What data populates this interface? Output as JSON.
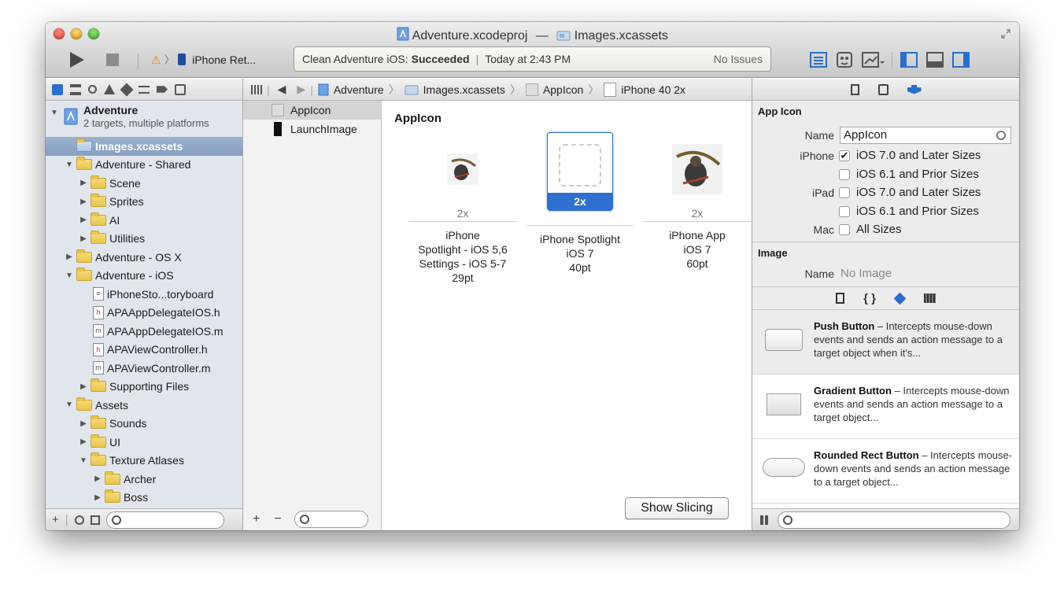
{
  "window": {
    "title_project": "Adventure.xcodeproj",
    "title_dash": "—",
    "title_assets": "Images.xcassets"
  },
  "toolbar": {
    "scheme_destination": "iPhone Ret...",
    "activity_prefix": "Clean Adventure iOS:",
    "activity_status": "Succeeded",
    "activity_sep": "|",
    "activity_time": "Today at 2:43 PM",
    "activity_issues": "No Issues"
  },
  "navigator": {
    "project_name": "Adventure",
    "project_sub": "2 targets, multiple platforms",
    "items": [
      {
        "label": "Images.xcassets",
        "indent": 1,
        "type": "xcassets",
        "selected": true,
        "disclosure": ""
      },
      {
        "label": "Adventure - Shared",
        "indent": 1,
        "type": "folder",
        "disclosure": "▼"
      },
      {
        "label": "Scene",
        "indent": 2,
        "type": "folder",
        "disclosure": "▶"
      },
      {
        "label": "Sprites",
        "indent": 2,
        "type": "folder",
        "disclosure": "▶"
      },
      {
        "label": "AI",
        "indent": 2,
        "type": "folder",
        "disclosure": "▶"
      },
      {
        "label": "Utilities",
        "indent": 2,
        "type": "folder",
        "disclosure": "▶"
      },
      {
        "label": "Adventure - OS X",
        "indent": 1,
        "type": "folder",
        "disclosure": "▶"
      },
      {
        "label": "Adventure - iOS",
        "indent": 1,
        "type": "folder",
        "disclosure": "▼"
      },
      {
        "label": "iPhoneSto...toryboard",
        "indent": 2,
        "type": "storyboard",
        "disclosure": ""
      },
      {
        "label": "APAAppDelegateIOS.h",
        "indent": 2,
        "type": "h",
        "disclosure": ""
      },
      {
        "label": "APAAppDelegateIOS.m",
        "indent": 2,
        "type": "m",
        "disclosure": ""
      },
      {
        "label": "APAViewController.h",
        "indent": 2,
        "type": "h",
        "disclosure": ""
      },
      {
        "label": "APAViewController.m",
        "indent": 2,
        "type": "m",
        "disclosure": ""
      },
      {
        "label": "Supporting Files",
        "indent": 2,
        "type": "folder",
        "disclosure": "▶"
      },
      {
        "label": "Assets",
        "indent": 1,
        "type": "folder",
        "disclosure": "▼"
      },
      {
        "label": "Sounds",
        "indent": 2,
        "type": "folder",
        "disclosure": "▶"
      },
      {
        "label": "UI",
        "indent": 2,
        "type": "folder",
        "disclosure": "▶"
      },
      {
        "label": "Texture Atlases",
        "indent": 2,
        "type": "folder",
        "disclosure": "▼"
      },
      {
        "label": "Archer",
        "indent": 3,
        "type": "folder",
        "disclosure": "▶"
      },
      {
        "label": "Boss",
        "indent": 3,
        "type": "folder",
        "disclosure": "▶"
      }
    ],
    "footer_add": "+"
  },
  "jumpbar": {
    "crumbs": [
      "Adventure",
      "Images.xcassets",
      "AppIcon",
      "iPhone 40 2x"
    ],
    "sep": "〉"
  },
  "sets": {
    "items": [
      {
        "label": "AppIcon",
        "selected": true
      },
      {
        "label": "LaunchImage",
        "selected": false
      }
    ],
    "footer_add": "+",
    "footer_remove": "−"
  },
  "editor": {
    "title": "AppIcon",
    "slots": [
      {
        "scale": "2x",
        "desc": [
          "iPhone",
          "Spotlight - iOS 5,6",
          "Settings - iOS 5-7",
          "29pt"
        ]
      },
      {
        "scale": "2x",
        "desc": [
          "iPhone Spotlight",
          "iOS 7",
          "40pt"
        ],
        "selected": true
      },
      {
        "scale": "2x",
        "desc": [
          "iPhone App",
          "iOS 7",
          "60pt"
        ]
      }
    ],
    "show_slicing": "Show Slicing"
  },
  "inspector": {
    "section_appicon": "App Icon",
    "name_label": "Name",
    "name_value": "AppIcon",
    "iphone_label": "iPhone",
    "ipad_label": "iPad",
    "mac_label": "Mac",
    "opt_ios7": "iOS 7.0 and Later Sizes",
    "opt_ios6": "iOS 6.1 and Prior Sizes",
    "opt_all": "All Sizes",
    "section_image": "Image",
    "image_name_label": "Name",
    "image_name_value": "No Image",
    "check_mark": "✔"
  },
  "library": {
    "items": [
      {
        "title": "Push Button",
        "desc": " – Intercepts mouse-down events and sends an action message to a target object when it's..."
      },
      {
        "title": "Gradient Button",
        "desc": " – Intercepts mouse-down events and sends an action message to a target object..."
      },
      {
        "title": "Rounded Rect Button",
        "desc": " – Intercepts mouse-down events and sends an action message to a target object..."
      }
    ]
  },
  "colors": {
    "accent": "#2f6fd0",
    "selection": "#879fc2",
    "sidebar": "#e1e6ed"
  }
}
